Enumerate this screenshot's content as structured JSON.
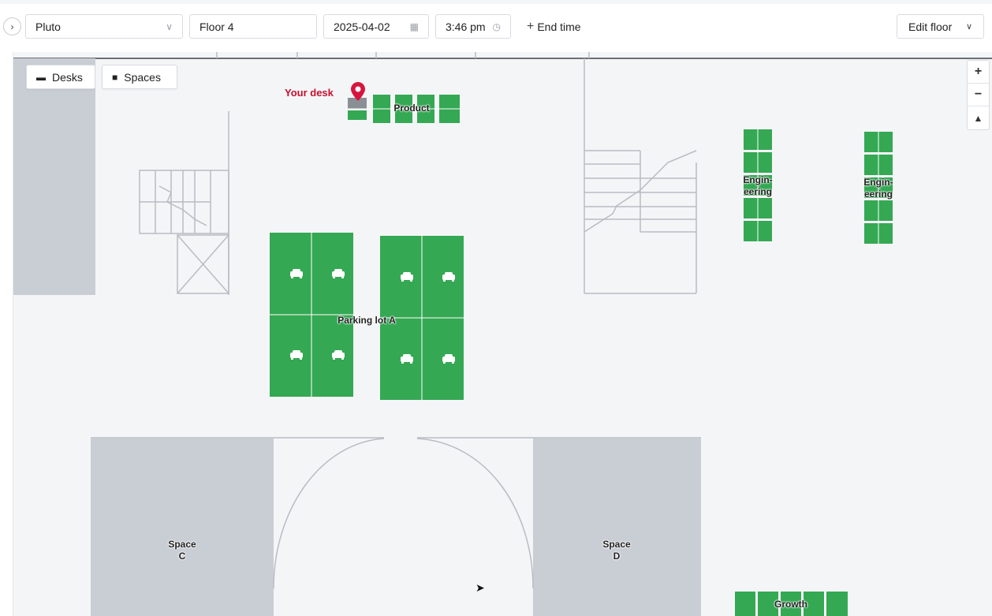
{
  "toolbar": {
    "collapse_icon": "chevron-right-icon",
    "location": "Pluto",
    "floor": "Floor 4",
    "date": "2025-04-02",
    "time": "3:46 pm",
    "end_time_label": "End time",
    "edit_floor_label": "Edit floor"
  },
  "map": {
    "filters": [
      {
        "label": "Desks",
        "icon": "desk-icon"
      },
      {
        "label": "Spaces",
        "icon": "cube-icon"
      }
    ],
    "zoom": {
      "in": "+",
      "out": "−",
      "reset": "compass-icon"
    },
    "your_desk_label": "Your desk",
    "areas": {
      "product": "Product",
      "engineering_left": "Engin-\neering",
      "engineering_right": "Engin-\neering",
      "parking": "Parking lot A",
      "space_c": "Space\nC",
      "space_d": "Space\nD",
      "growth": "Growth"
    },
    "colors": {
      "available": "#34a853",
      "room": "#c9cdd4",
      "highlight": "#c8102e",
      "background": "#f4f5f7"
    }
  }
}
